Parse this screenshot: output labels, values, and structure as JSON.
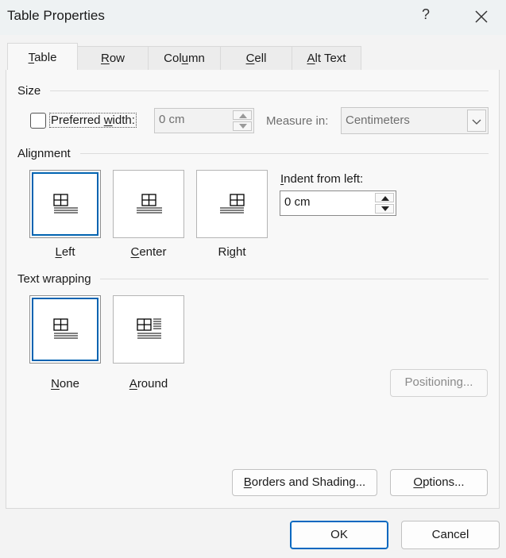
{
  "window": {
    "title": "Table Properties",
    "help_glyph": "?"
  },
  "tabs": [
    {
      "label": "Table",
      "mnemonic": "T",
      "rest": "able",
      "active": true
    },
    {
      "label": "Row",
      "mnemonic": "R",
      "rest": "ow"
    },
    {
      "label": "Column",
      "pre": "Col",
      "mnemonic": "u",
      "rest": "mn"
    },
    {
      "label": "Cell",
      "mnemonic": "C",
      "pre": "",
      "rest": "ell"
    },
    {
      "label": "Alt Text",
      "mnemonic": "A",
      "rest": "lt Text"
    }
  ],
  "size": {
    "heading": "Size",
    "preferred_width_pre": "Preferred ",
    "preferred_width_mn": "w",
    "preferred_width_post": "idth:",
    "preferred_width_checked": false,
    "width_value": "0 cm",
    "measure_in_label": "Measure in:",
    "measure_in_value": "Centimeters"
  },
  "alignment": {
    "heading": "Alignment",
    "options": [
      {
        "label": "Left",
        "mn": "L",
        "rest": "eft",
        "selected": true
      },
      {
        "label": "Center",
        "mn": "C",
        "rest": "enter"
      },
      {
        "label": "Right",
        "pre": "Ri",
        "mn": "g",
        "rest": "ht"
      }
    ],
    "indent_label_pre": "",
    "indent_label_mn": "I",
    "indent_label_post": "ndent from left:",
    "indent_value": "0 cm"
  },
  "text_wrapping": {
    "heading": "Text wrapping",
    "options": [
      {
        "label": "None",
        "mn": "N",
        "rest": "one",
        "selected": true
      },
      {
        "label": "Around",
        "mn": "A",
        "rest": "round"
      }
    ],
    "positioning_label": "Positioning...",
    "positioning_enabled": false
  },
  "buttons": {
    "borders_mn": "B",
    "borders_rest": "orders and Shading...",
    "options_mn": "O",
    "options_rest": "ptions...",
    "ok": "OK",
    "cancel": "Cancel"
  },
  "colors": {
    "accent": "#0063b1",
    "ok_border": "#0067c0"
  }
}
